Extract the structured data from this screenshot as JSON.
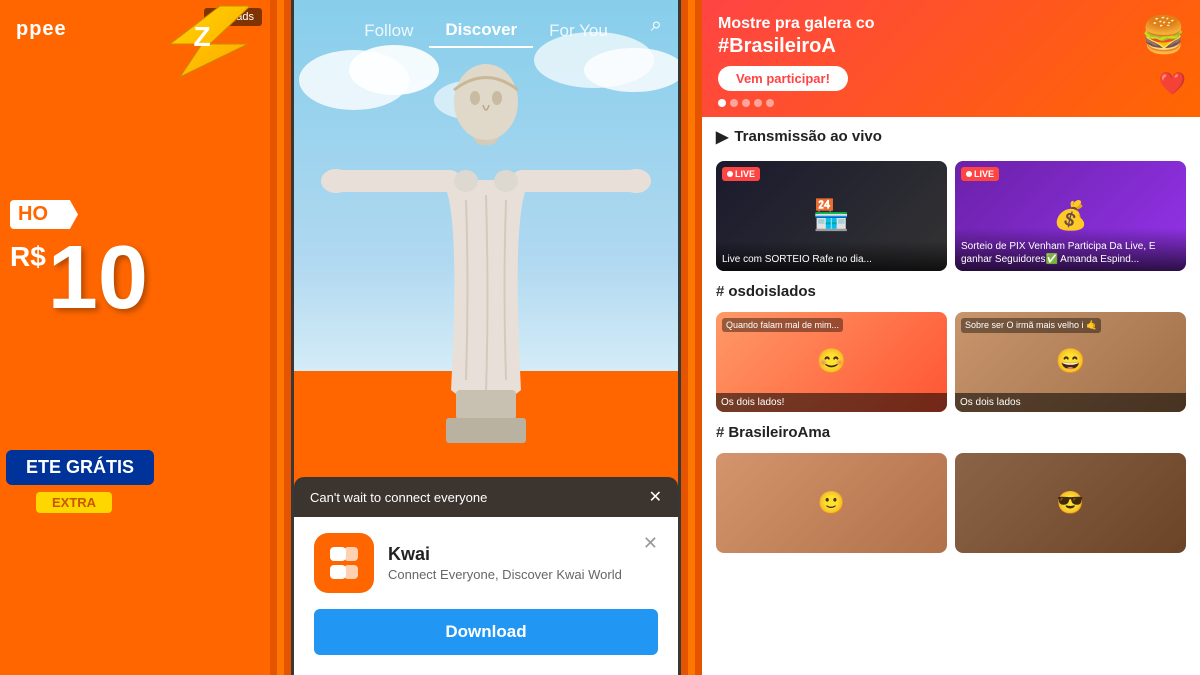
{
  "left_panel": {
    "logo": "ppee",
    "skip_ads": "Skip ads",
    "price_label": "HO",
    "price_prefix": "R$",
    "price_value": "10",
    "frete": "ETE GRÁTIS",
    "extra": "EXTRA"
  },
  "phone": {
    "nav": {
      "follow": "Follow",
      "discover": "Discover",
      "for_you": "For You"
    },
    "popup": {
      "header": "Can't wait to connect everyone",
      "app_name": "Kwai",
      "app_desc": "Connect Everyone, Discover Kwai World",
      "download_btn": "Download"
    }
  },
  "right_panel": {
    "banner": {
      "title": "Mostre pra galera co",
      "hashtag": "#BrasileiroA",
      "cta": "Vem participar!",
      "dots": [
        1,
        2,
        3,
        4,
        5
      ]
    },
    "live_section": {
      "label": "Transmissão ao vivo",
      "icon": "▶"
    },
    "live_cards": [
      {
        "badge": "LIVE",
        "label": "Live com SORTEIO\nRafe no dia..."
      },
      {
        "badge": "LIVE",
        "label": "Sorteio de PIX\nVenham Participa\nDa Live, E\nganhar\nSeguidores✅\nAmanda Espind..."
      }
    ],
    "hash_osdois": {
      "symbol": "#",
      "label": "osdoislados"
    },
    "hash_cards": [
      {
        "overlay": "Quando falam mal de mim...",
        "label": "Os dois lados!"
      },
      {
        "overlay": "Sobre ser O irmã mais\nvelho i 🤙",
        "label": "Os dois lados"
      }
    ],
    "hash_brasileiro": {
      "symbol": "#",
      "label": "BrasileiroAma"
    },
    "brasileiro_cards": [
      {},
      {}
    ]
  }
}
